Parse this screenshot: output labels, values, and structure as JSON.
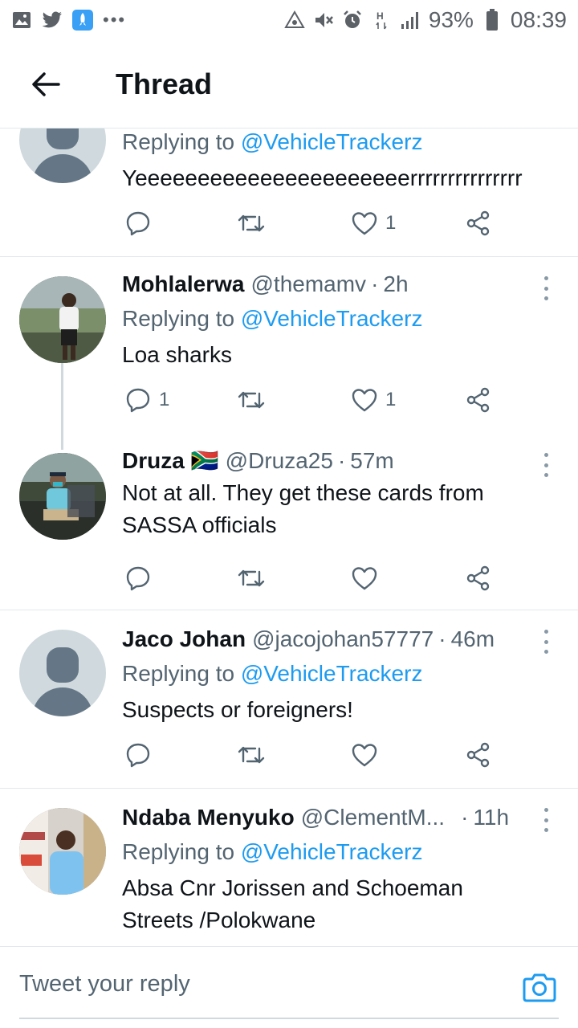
{
  "status_bar": {
    "battery_percent": "93%",
    "time": "08:39",
    "left_icons": [
      "gallery-icon",
      "twitter-icon",
      "rocket-app-icon",
      "more-dots-icon"
    ],
    "right_icons": [
      "recycle-icon",
      "mute-icon",
      "alarm-icon",
      "network-h-icon",
      "signal-icon",
      "battery-icon"
    ]
  },
  "header": {
    "title": "Thread"
  },
  "tweets": [
    {
      "name": "",
      "handle": "",
      "time": "",
      "replying_prefix": "Replying to",
      "replying_to": "@VehicleTrackerz",
      "text": "Yeeeeeeeeeeeeeeeeeeeeeerrrrrrrrrrrrrrr",
      "replies": "",
      "likes": "1"
    },
    {
      "name": "Mohlalerwa",
      "handle": "@themamv",
      "time": "2h",
      "replying_prefix": "Replying to",
      "replying_to": "@VehicleTrackerz",
      "text": "Loa  sharks",
      "replies": "1",
      "likes": "1"
    },
    {
      "name": "Druza",
      "flag": "🇿🇦",
      "handle": "@Druza25",
      "time": "57m",
      "text": "Not at all. They get these cards from SASSA officials",
      "replies": "",
      "likes": ""
    },
    {
      "name": "Jaco Johan",
      "handle": "@jacojohan57777",
      "time": "46m",
      "replying_prefix": "Replying to",
      "replying_to": "@VehicleTrackerz",
      "text": "Suspects or foreigners!",
      "replies": "",
      "likes": ""
    },
    {
      "name": "Ndaba Menyuko",
      "handle": "@ClementM...",
      "time": "11h",
      "replying_prefix": "Replying to",
      "replying_to": "@VehicleTrackerz",
      "text": "Absa Cnr Jorissen and Schoeman Streets /Polokwane"
    }
  ],
  "reply_bar": {
    "placeholder": "Tweet your reply"
  },
  "colors": {
    "link": "#1d9bf0",
    "secondary_text": "#536471",
    "divider": "#e1e8ed"
  }
}
